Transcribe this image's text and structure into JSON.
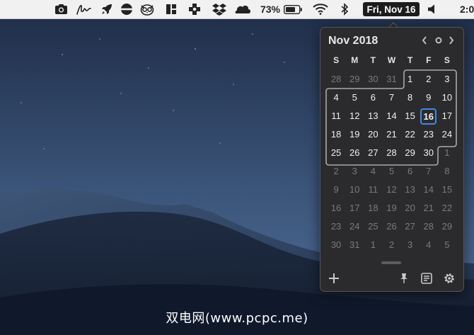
{
  "menubar": {
    "icons": [
      "camera-icon",
      "signature-icon",
      "rocket-icon",
      "globe-icon",
      "owl-icon",
      "window-tiles-icon",
      "medical-plus-icon",
      "dropbox-icon",
      "cloud-icon",
      "battery-icon",
      "wifi-icon",
      "bluetooth-icon",
      "speaker-icon"
    ],
    "battery_percent": "73%",
    "date_label": "Fri, Nov 16",
    "clock_partial": "2:0"
  },
  "calendar": {
    "month_title": "Nov 2018",
    "weekdays": [
      "S",
      "M",
      "T",
      "W",
      "T",
      "F",
      "S"
    ],
    "weeks": [
      [
        "28",
        "29",
        "30",
        "31",
        "1",
        "2",
        "3"
      ],
      [
        "4",
        "5",
        "6",
        "7",
        "8",
        "9",
        "10"
      ],
      [
        "11",
        "12",
        "13",
        "14",
        "15",
        "16",
        "17"
      ],
      [
        "18",
        "19",
        "20",
        "21",
        "22",
        "23",
        "24"
      ],
      [
        "25",
        "26",
        "27",
        "28",
        "29",
        "30",
        "1"
      ],
      [
        "2",
        "3",
        "4",
        "5",
        "6",
        "7",
        "8"
      ],
      [
        "9",
        "10",
        "11",
        "12",
        "13",
        "14",
        "15"
      ],
      [
        "16",
        "17",
        "18",
        "19",
        "20",
        "21",
        "22"
      ],
      [
        "23",
        "24",
        "25",
        "26",
        "27",
        "28",
        "29"
      ],
      [
        "30",
        "31",
        "1",
        "2",
        "3",
        "4",
        "5"
      ]
    ],
    "today": "16",
    "accent_color": "#3f88e6"
  },
  "watermark": "双电网(www.pcpc.me)"
}
